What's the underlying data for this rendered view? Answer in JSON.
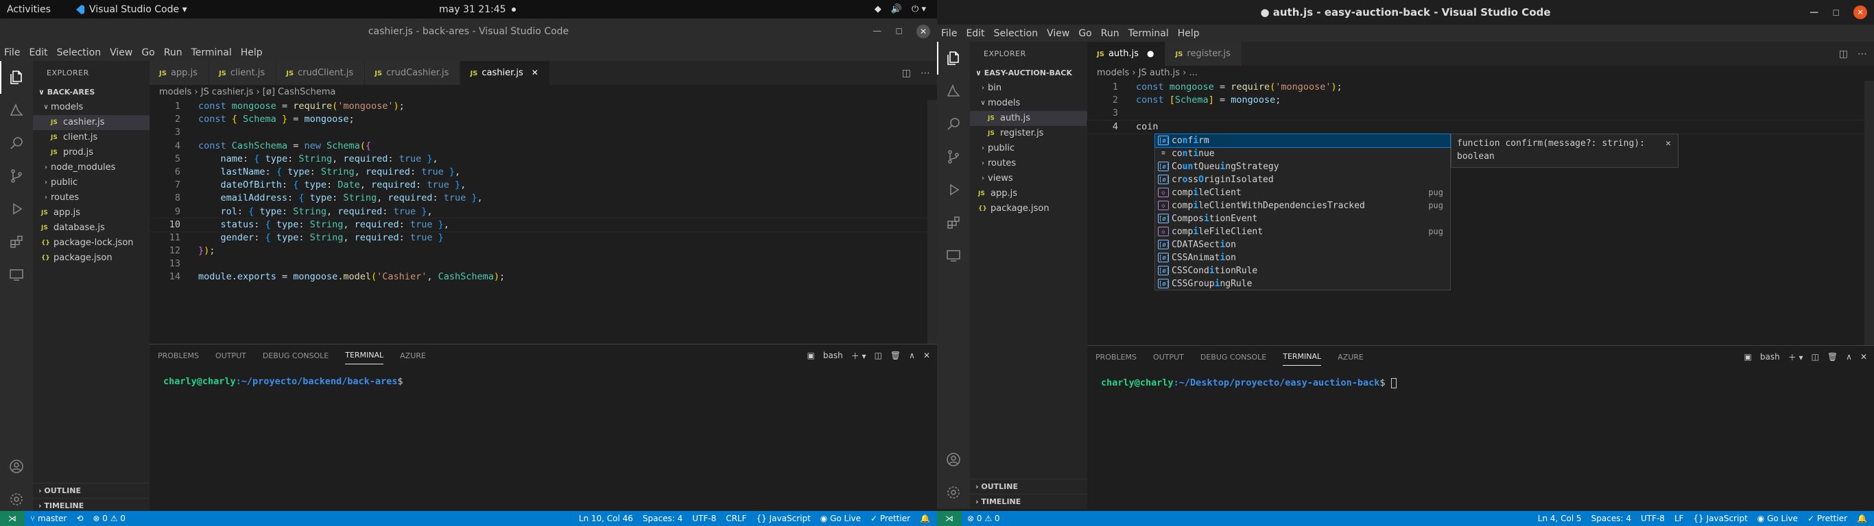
{
  "gnome": {
    "activities": "Activities",
    "app": "Visual Studio Code ▾",
    "clock": "may 31  21:45",
    "tray": [
      "▾",
      "🔊",
      "⏻ ▾"
    ]
  },
  "w1": {
    "title": "cashier.js - back-ares - Visual Studio Code",
    "menu": [
      "File",
      "Edit",
      "Selection",
      "View",
      "Go",
      "Run",
      "Terminal",
      "Help"
    ],
    "explorer": "EXPLORER",
    "root": "BACK-ARES",
    "tree": [
      {
        "label": "models",
        "chev": "∨",
        "depth": 1
      },
      {
        "label": "cashier.js",
        "icon": "JS",
        "depth": 2,
        "sel": true
      },
      {
        "label": "client.js",
        "icon": "JS",
        "depth": 2
      },
      {
        "label": "prod.js",
        "icon": "JS",
        "depth": 2
      },
      {
        "label": "node_modules",
        "chev": "›",
        "depth": 1
      },
      {
        "label": "public",
        "chev": "›",
        "depth": 1
      },
      {
        "label": "routes",
        "chev": "›",
        "depth": 1
      },
      {
        "label": "app.js",
        "icon": "JS",
        "depth": 1
      },
      {
        "label": "database.js",
        "icon": "JS",
        "depth": 1
      },
      {
        "label": "package-lock.json",
        "icon": "{}",
        "depth": 1
      },
      {
        "label": "package.json",
        "icon": "{}",
        "depth": 1
      }
    ],
    "outline": "OUTLINE",
    "timeline": "TIMELINE",
    "tabs": [
      {
        "label": "app.js"
      },
      {
        "label": "client.js"
      },
      {
        "label": "crudClient.js"
      },
      {
        "label": "crudCashier.js"
      },
      {
        "label": "cashier.js",
        "active": true
      }
    ],
    "breadcrumb": "models  ›  JS cashier.js  ›  [ø] CashSchema",
    "panel_tabs": [
      "PROBLEMS",
      "OUTPUT",
      "DEBUG CONSOLE",
      "TERMINAL",
      "AZURE"
    ],
    "shell": "bash",
    "term_user": "charly@charly",
    "term_path": ":~/proyecto/backend/back-ares",
    "term_prompt": "$",
    "status_left": [
      "master",
      "⟲",
      "⊗ 0  ⚠ 0"
    ],
    "status_right": [
      "Ln 10, Col 46",
      "Spaces: 4",
      "UTF-8",
      "CRLF",
      "{} JavaScript",
      "◉ Go Live",
      "✓ Prettier",
      "🔔"
    ]
  },
  "w2": {
    "title": "● auth.js - easy-auction-back - Visual Studio Code",
    "menu": [
      "File",
      "Edit",
      "Selection",
      "View",
      "Go",
      "Run",
      "Terminal",
      "Help"
    ],
    "explorer": "EXPLORER",
    "root": "EASY-AUCTION-BACK",
    "tree": [
      {
        "label": "bin",
        "chev": "›",
        "depth": 1
      },
      {
        "label": "models",
        "chev": "∨",
        "depth": 1
      },
      {
        "label": "auth.js",
        "icon": "JS",
        "depth": 2,
        "sel": true
      },
      {
        "label": "register.js",
        "icon": "JS",
        "depth": 2
      },
      {
        "label": "public",
        "chev": "›",
        "depth": 1
      },
      {
        "label": "routes",
        "chev": "›",
        "depth": 1
      },
      {
        "label": "views",
        "chev": "›",
        "depth": 1
      },
      {
        "label": "app.js",
        "icon": "JS",
        "depth": 1
      },
      {
        "label": "package.json",
        "icon": "{}",
        "depth": 1
      }
    ],
    "outline": "OUTLINE",
    "timeline": "TIMELINE",
    "tabs": [
      {
        "label": "auth.js",
        "active": true,
        "dirty": true
      },
      {
        "label": "register.js"
      }
    ],
    "breadcrumb": "models  ›  JS auth.js  ›  ...",
    "suggestions": [
      {
        "pre": "co",
        "hl": "n",
        "mid": "f",
        "hl2": "i",
        "post": "rm",
        "kind": "v",
        "sel": true
      },
      {
        "pre": "co",
        "hl": "n",
        "mid": "t",
        "hl2": "i",
        "post": "nue",
        "kind": "k"
      },
      {
        "pre": "Co",
        "hl": "un",
        "mid": "tQueu",
        "hl2": "i",
        "post": "ngStrategy",
        "kind": "v"
      },
      {
        "pre": "cr",
        "hl": "o",
        "mid": "ss",
        "hl2": "O",
        "post": "riginIsolated",
        "kind": "v"
      },
      {
        "pre": "co",
        "hl": "",
        "mid": "mp",
        "hl2": "i",
        "post": "leClient",
        "kind": "m",
        "src": "pug"
      },
      {
        "pre": "co",
        "hl": "",
        "mid": "mp",
        "hl2": "i",
        "post": "leClientWithDependenciesTracked",
        "kind": "m",
        "src": "pug"
      },
      {
        "pre": "Co",
        "hl": "",
        "mid": "mpos",
        "hl2": "i",
        "post": "tionEvent",
        "kind": "v"
      },
      {
        "pre": "co",
        "hl": "",
        "mid": "mp",
        "hl2": "i",
        "post": "leFileClient",
        "kind": "m",
        "src": "pug"
      },
      {
        "pre": "C",
        "hl": "",
        "mid": "DATASect",
        "hl2": "i",
        "post": "on",
        "kind": "v"
      },
      {
        "pre": "C",
        "hl": "",
        "mid": "SSAnimat",
        "hl2": "i",
        "post": "on",
        "kind": "v"
      },
      {
        "pre": "C",
        "hl": "",
        "mid": "SSCond",
        "hl2": "i",
        "post": "tionRule",
        "kind": "v"
      },
      {
        "pre": "C",
        "hl": "",
        "mid": "SSGroup",
        "hl2": "i",
        "post": "ngRule",
        "kind": "v"
      }
    ],
    "detail": {
      "sig": "function confirm(message?: string):",
      "ret": "boolean",
      "close": "✕"
    },
    "panel_tabs": [
      "PROBLEMS",
      "OUTPUT",
      "DEBUG CONSOLE",
      "TERMINAL",
      "AZURE"
    ],
    "shell": "bash",
    "term_user": "charly@charly",
    "term_path": ":~/Desktop/proyecto/easy-auction-back",
    "term_prompt": "$ ",
    "status_left": [
      "⊗ 0  ⚠ 0"
    ],
    "status_right": [
      "Ln 4, Col 5",
      "Spaces: 4",
      "UTF-8",
      "LF",
      "{} JavaScript",
      "◉ Go Live",
      "✓ Prettier",
      "🔔"
    ]
  },
  "code1": [
    [
      [
        "kw",
        "const "
      ],
      [
        "cl",
        "mongoose"
      ],
      [
        "pu",
        " = "
      ],
      [
        "fn",
        "require"
      ],
      [
        "br1",
        "("
      ],
      [
        "st",
        "'mongoose'"
      ],
      [
        "br1",
        ")"
      ],
      [
        "pu",
        ";"
      ]
    ],
    [
      [
        "kw",
        "const "
      ],
      [
        "br1",
        "{ "
      ],
      [
        "cl",
        "Schema"
      ],
      [
        "br1",
        " }"
      ],
      [
        "pu",
        " = "
      ],
      [
        "pr",
        "mongoose"
      ],
      [
        "pu",
        ";"
      ]
    ],
    [],
    [
      [
        "kw",
        "const "
      ],
      [
        "cl",
        "CashSchema"
      ],
      [
        "pu",
        " = "
      ],
      [
        "kw",
        "new "
      ],
      [
        "cl",
        "Schema"
      ],
      [
        "br1",
        "("
      ],
      [
        "br2",
        "{"
      ]
    ],
    [
      [
        "pr",
        "    name"
      ],
      [
        "pu",
        ": "
      ],
      [
        "br3",
        "{ "
      ],
      [
        "pr",
        "type"
      ],
      [
        "pu",
        ": "
      ],
      [
        "cl",
        "String"
      ],
      [
        "pu",
        ", "
      ],
      [
        "pr",
        "required"
      ],
      [
        "pu",
        ": "
      ],
      [
        "tr",
        "true"
      ],
      [
        "br3",
        " }"
      ],
      [
        "pu",
        ","
      ]
    ],
    [
      [
        "pr",
        "    lastName"
      ],
      [
        "pu",
        ": "
      ],
      [
        "br3",
        "{ "
      ],
      [
        "pr",
        "type"
      ],
      [
        "pu",
        ": "
      ],
      [
        "cl",
        "String"
      ],
      [
        "pu",
        ", "
      ],
      [
        "pr",
        "required"
      ],
      [
        "pu",
        ": "
      ],
      [
        "tr",
        "true"
      ],
      [
        "br3",
        " }"
      ],
      [
        "pu",
        ","
      ]
    ],
    [
      [
        "pr",
        "    dateOfBirth"
      ],
      [
        "pu",
        ": "
      ],
      [
        "br3",
        "{ "
      ],
      [
        "pr",
        "type"
      ],
      [
        "pu",
        ": "
      ],
      [
        "cl",
        "Date"
      ],
      [
        "pu",
        ", "
      ],
      [
        "pr",
        "required"
      ],
      [
        "pu",
        ": "
      ],
      [
        "tr",
        "true"
      ],
      [
        "br3",
        " }"
      ],
      [
        "pu",
        ","
      ]
    ],
    [
      [
        "pr",
        "    emailAddress"
      ],
      [
        "pu",
        ": "
      ],
      [
        "br3",
        "{ "
      ],
      [
        "pr",
        "type"
      ],
      [
        "pu",
        ": "
      ],
      [
        "cl",
        "String"
      ],
      [
        "pu",
        ", "
      ],
      [
        "pr",
        "required"
      ],
      [
        "pu",
        ": "
      ],
      [
        "tr",
        "true"
      ],
      [
        "br3",
        " }"
      ],
      [
        "pu",
        ","
      ]
    ],
    [
      [
        "pr",
        "    rol"
      ],
      [
        "pu",
        ": "
      ],
      [
        "br3",
        "{ "
      ],
      [
        "pr",
        "type"
      ],
      [
        "pu",
        ": "
      ],
      [
        "cl",
        "String"
      ],
      [
        "pu",
        ", "
      ],
      [
        "pr",
        "required"
      ],
      [
        "pu",
        ": "
      ],
      [
        "tr",
        "true"
      ],
      [
        "br3",
        " }"
      ],
      [
        "pu",
        ","
      ]
    ],
    [
      [
        "pr",
        "    status"
      ],
      [
        "pu",
        ": "
      ],
      [
        "br3",
        "{ "
      ],
      [
        "pr",
        "type"
      ],
      [
        "pu",
        ": "
      ],
      [
        "cl",
        "String"
      ],
      [
        "pu",
        ", "
      ],
      [
        "pr",
        "required"
      ],
      [
        "pu",
        ": "
      ],
      [
        "tr",
        "true"
      ],
      [
        "br3",
        " }"
      ],
      [
        "pu",
        ","
      ]
    ],
    [
      [
        "pr",
        "    gender"
      ],
      [
        "pu",
        ": "
      ],
      [
        "br3",
        "{ "
      ],
      [
        "pr",
        "type"
      ],
      [
        "pu",
        ": "
      ],
      [
        "cl",
        "String"
      ],
      [
        "pu",
        ", "
      ],
      [
        "pr",
        "required"
      ],
      [
        "pu",
        ": "
      ],
      [
        "tr",
        "true"
      ],
      [
        "br3",
        " }"
      ]
    ],
    [
      [
        "br2",
        "}"
      ],
      [
        "br1",
        ")"
      ],
      [
        "pu",
        ";"
      ]
    ],
    [],
    [
      [
        "pr",
        "module"
      ],
      [
        "pu",
        "."
      ],
      [
        "pr",
        "exports"
      ],
      [
        "pu",
        " = "
      ],
      [
        "pr",
        "mongoose"
      ],
      [
        "pu",
        "."
      ],
      [
        "fn",
        "model"
      ],
      [
        "br1",
        "("
      ],
      [
        "st",
        "'Cashier'"
      ],
      [
        "pu",
        ", "
      ],
      [
        "cl",
        "CashSchema"
      ],
      [
        "br1",
        ")"
      ],
      [
        "pu",
        ";"
      ]
    ]
  ],
  "code2": [
    [
      [
        "kw",
        "const "
      ],
      [
        "cl",
        "mongoose"
      ],
      [
        "pu",
        " = "
      ],
      [
        "fn",
        "require"
      ],
      [
        "br1",
        "("
      ],
      [
        "st",
        "'mongoose'"
      ],
      [
        "br1",
        ")"
      ],
      [
        "pu",
        ";"
      ]
    ],
    [
      [
        "kw",
        "const "
      ],
      [
        "br1",
        "["
      ],
      [
        "cl",
        "Schema"
      ],
      [
        "br1",
        "]"
      ],
      [
        "pu",
        " = "
      ],
      [
        "pr",
        "mongoose"
      ],
      [
        "pu",
        ";"
      ]
    ],
    [],
    [
      [
        "pu",
        "coin"
      ]
    ]
  ]
}
